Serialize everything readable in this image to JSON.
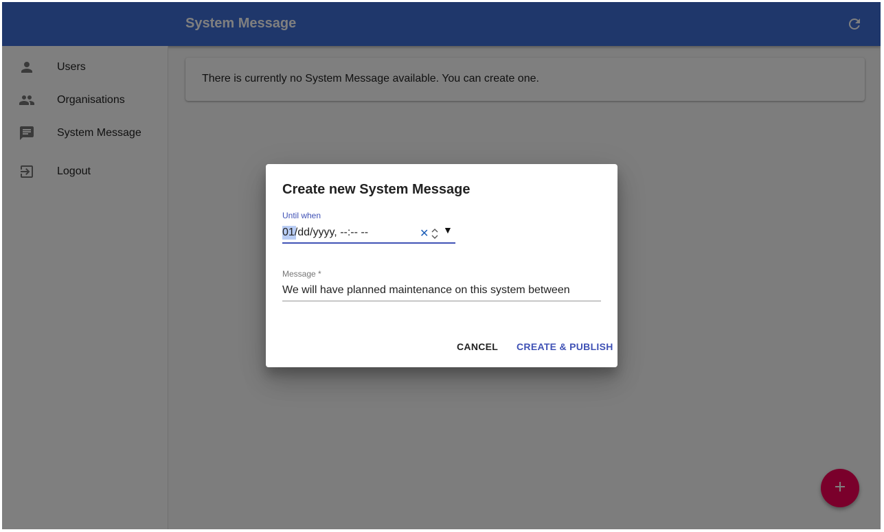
{
  "appbar": {
    "title": "System Message",
    "refresh_icon": "refresh-icon"
  },
  "sidebar": {
    "items": [
      {
        "label": "Users",
        "icon": "person-icon"
      },
      {
        "label": "Organisations",
        "icon": "people-icon"
      },
      {
        "label": "System Message",
        "icon": "chat-icon"
      },
      {
        "label": "Logout",
        "icon": "logout-icon"
      }
    ]
  },
  "main": {
    "empty_message": "There is currently no System Message available. You can create one."
  },
  "fab": {
    "icon": "plus-icon"
  },
  "dialog": {
    "title": "Create new System Message",
    "until_label": "Until when",
    "until_value": "01/dd/yyyy, --:-- --",
    "message_label": "Message *",
    "message_value": "We will have planned maintenance on this system between",
    "cancel_label": "CANCEL",
    "create_label": "CREATE & PUBLISH"
  },
  "colors": {
    "appbar": "#3f6fd6",
    "accent": "#3f51b5",
    "fab": "#f50057"
  }
}
